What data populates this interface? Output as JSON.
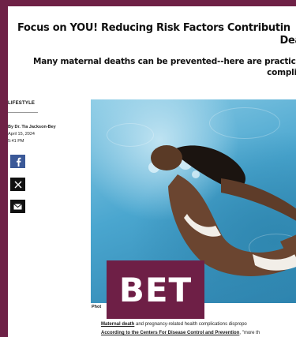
{
  "article": {
    "headline_line1": "Focus on YOU! Reducing Risk Factors Contributin",
    "headline_line2": "Dea",
    "dek_line1": "Many maternal deaths can be prevented--here are practical",
    "dek_line2": "complic",
    "section": "LIFESTYLE",
    "author": "By Dr. Tia Jackson-Bey",
    "date": "April 15, 2024",
    "time": "5:41 PM",
    "photo_credit": "Phot",
    "body_link1": "Maternal death",
    "body_line1_rest": " and pregnancy-related health complications dispropo",
    "body_link2": "According to the Centers For Disease Control and Prevention",
    "body_line2_rest": ", \"more th"
  },
  "share": {
    "facebook_icon": "facebook-icon",
    "x_icon": "x-icon",
    "email_icon": "email-icon"
  },
  "brand": {
    "logo_text": "BET",
    "color": "#6e1f46"
  }
}
